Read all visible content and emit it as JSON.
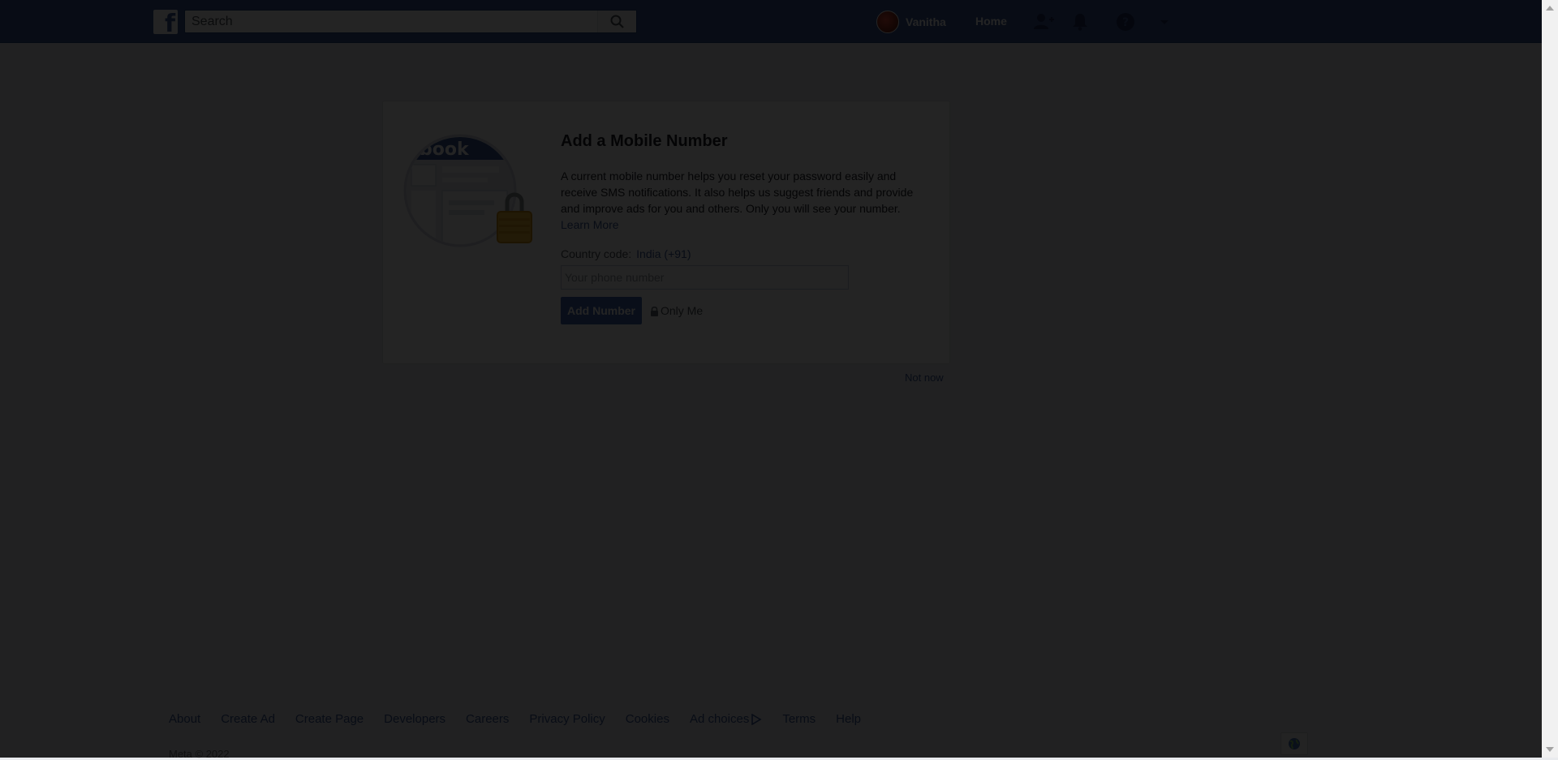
{
  "header": {
    "search_placeholder": "Search",
    "user_name": "Vanitha",
    "home_label": "Home"
  },
  "card": {
    "title": "Add a Mobile Number",
    "description": "A current mobile number helps you reset your password easily and receive SMS notifications. It also helps us suggest friends and provide and improve ads for you and others. Only you will see your number.",
    "learn_more": "Learn More",
    "country_label": "Country code:",
    "country_value": "India (+91)",
    "phone_placeholder": "Your phone number",
    "add_button": "Add Number",
    "privacy_label": "Only Me",
    "not_now": "Not now"
  },
  "footer": {
    "links": [
      "About",
      "Create Ad",
      "Create Page",
      "Developers",
      "Careers",
      "Privacy Policy",
      "Cookies",
      "Ad choices",
      "Terms",
      "Help"
    ],
    "copyright": "Meta © 2022"
  },
  "colors": {
    "brand": "#3b5998",
    "button": "#4267b2",
    "link": "#385898"
  }
}
